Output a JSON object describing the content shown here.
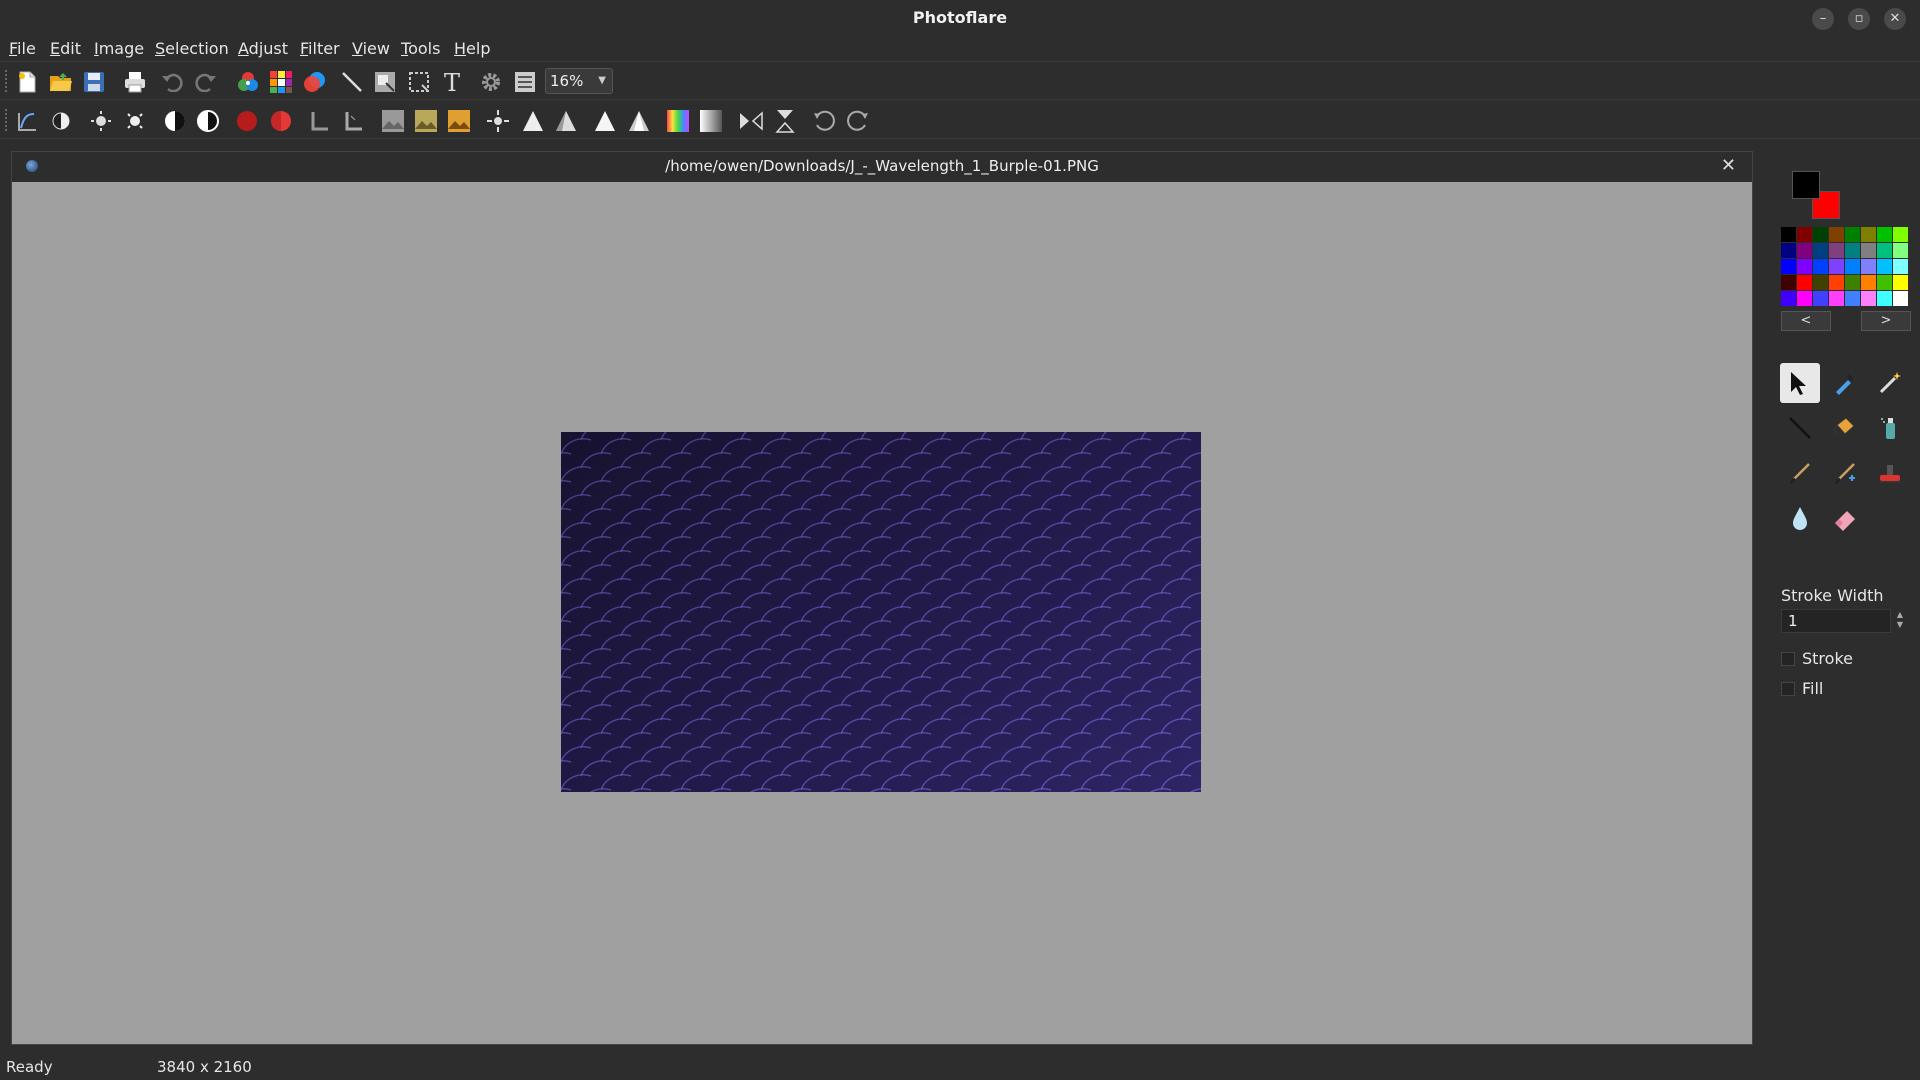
{
  "window": {
    "title": "Photoflare"
  },
  "menu": [
    "File",
    "Edit",
    "Image",
    "Selection",
    "Adjust",
    "Filter",
    "View",
    "Tools",
    "Help"
  ],
  "toolbar": {
    "zoom": "16%"
  },
  "document": {
    "path": "/home/owen/Downloads/J_-_Wavelength_1_Burple-01.PNG"
  },
  "colors": {
    "primary": "#000000",
    "secondary": "#ff0000",
    "image_bg": "#261d52",
    "wave_stroke": "#6a5cc4"
  },
  "palette_nav": {
    "prev": "<",
    "next": ">"
  },
  "tools": [
    "pointer-icon",
    "color-picker-icon",
    "magic-wand-icon",
    "line-icon",
    "paint-bucket-icon",
    "spray-can-icon",
    "paintbrush-icon",
    "paintbrush-plus-icon",
    "stamp-icon",
    "blur-drop-icon",
    "eraser-icon"
  ],
  "tool_settings": {
    "stroke_width_label": "Stroke Width",
    "stroke_width_value": "1",
    "stroke_label": "Stroke",
    "fill_label": "Fill"
  },
  "status": {
    "state": "Ready",
    "dimensions": "3840 x 2160"
  }
}
